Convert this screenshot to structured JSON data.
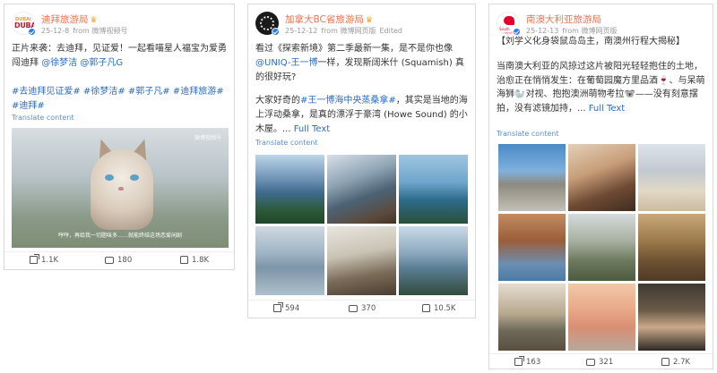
{
  "posts": [
    {
      "author": "迪拜旅游局",
      "avatar_text_top": "DUBAI",
      "avatar_text_bottom": "DUBAI",
      "date": "25-12-8",
      "source": "from 微博视频号",
      "text_plain": "正片来袭：去迪拜，见证爱！一起看喵星人福宝为爱勇闯迪拜 ",
      "mention_1": "@徐梦洁",
      "mention_2": "@郭子凡G",
      "hashtags": "#去迪拜见证爱# #徐梦洁# #郭子凡# #迪拜旅游# #迪拜#",
      "translate": "Translate content",
      "video_watermark": "微博视频号",
      "video_subtitle": "哼哼，再给我一切脂味多……就能终结这场恋爱闲剧",
      "stats": {
        "shares": "1.1K",
        "comments": "180",
        "likes": "1.8K"
      }
    },
    {
      "author": "加拿大BC省旅游局",
      "date": "25-12-12",
      "source": "from 微博网页版",
      "edited": "Edited",
      "text_part1": "看过《探索新境》第二季最新一集，是不是你也像",
      "mention": "@UNIQ-王一博",
      "text_part2": "一样，发现斯阔米什 (Squamish) 真的很好玩?",
      "text_part3": "大家好奇的",
      "hashtag": "#王一博海中央蒸桑拿#",
      "text_part4": "，其实是当地的海上浮动桑拿，是真的漂浮于豪湾 (Howe Sound) 的小木屋。... ",
      "full_text": "Full Text",
      "translate": "Translate content",
      "stats": {
        "shares": "594",
        "comments": "370",
        "likes": "10.5K"
      }
    },
    {
      "author": "南澳大利亚旅游局",
      "avatar_label": "South Australia",
      "date": "25-12-13",
      "source": "from 微博网页版",
      "text_line1": "【刘学义化身袋鼠岛岛主，南澳州行程大揭秘】",
      "text_body": "当南澳大利亚的风掠过这片被阳光轻轻抱住的土地，治愈正在悄悄发生：在葡萄园魔方里品酒🍷、与呆萌海狮🦭对视、抱抱澳洲萌物考拉🐨——没有刻意摆拍，没有滤镜加持，... ",
      "full_text": "Full Text",
      "translate": "Translate content",
      "stats": {
        "shares": "163",
        "comments": "321",
        "likes": "2.7K"
      }
    }
  ],
  "colors": {
    "author": "#eb7350",
    "link": "#2b6cc4",
    "meta": "#999999",
    "verified": "#2b7de9"
  },
  "icons": [
    "verified-badge-icon",
    "crown-icon",
    "share-icon",
    "comment-icon",
    "like-icon"
  ]
}
